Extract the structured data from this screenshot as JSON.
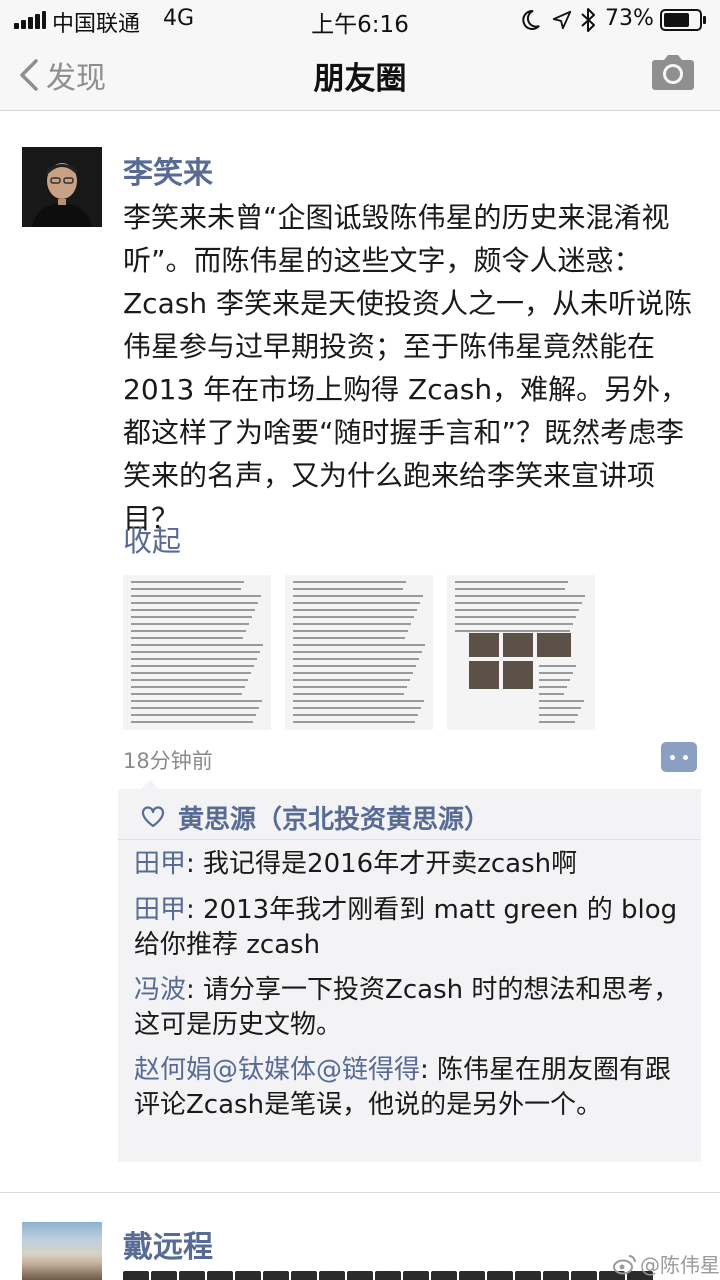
{
  "status_bar": {
    "carrier": "中国联通",
    "network": "4G",
    "time": "上午6:16",
    "battery_percent": "73%",
    "battery_level": 0.73
  },
  "nav": {
    "back_label": "发现",
    "title": "朋友圈"
  },
  "post": {
    "author": "李笑来",
    "text": "李笑来未曾“企图诋毁陈伟星的历史来混淆视听”。而陈伟星的这些文字，颇令人迷惑：Zcash 李笑来是天使投资人之一，从未听说陈伟星参与过早期投资；至于陈伟星竟然能在 2013 年在市场上购得 Zcash，难解。另外，都这样了为啥要“随时握手言和”？既然考虑李笑来的名声，又为什么跑来给李笑来宣讲项目？",
    "collapse_label": "收起",
    "time": "18分钟前",
    "likes": "黄思源（京北投资黄思源）",
    "comments": [
      {
        "name": "田甲",
        "text": ": 我记得是2016年才开卖zcash啊"
      },
      {
        "name": "田甲",
        "text": ": 2013年我才刚看到 matt green 的 blog 给你推荐 zcash"
      },
      {
        "name": "冯波",
        "text": ": 请分享一下投资Zcash 时的想法和思考，这可是历史文物。"
      },
      {
        "name": "赵何娟@钛媒体@链得得",
        "text": ": 陈伟星在朋友圈有跟评论Zcash是笔误，他说的是另外一个。"
      }
    ]
  },
  "next_post": {
    "author": "戴远程"
  },
  "watermark": "@陈伟星",
  "icons": {
    "back": "chevron-left-icon",
    "camera": "camera-icon",
    "like": "heart-outline-icon",
    "comment": "comment-dots-icon"
  },
  "colors": {
    "link": "#576b95",
    "bar_bg": "#f7f7f7",
    "comment_bg": "#f3f3f5"
  }
}
